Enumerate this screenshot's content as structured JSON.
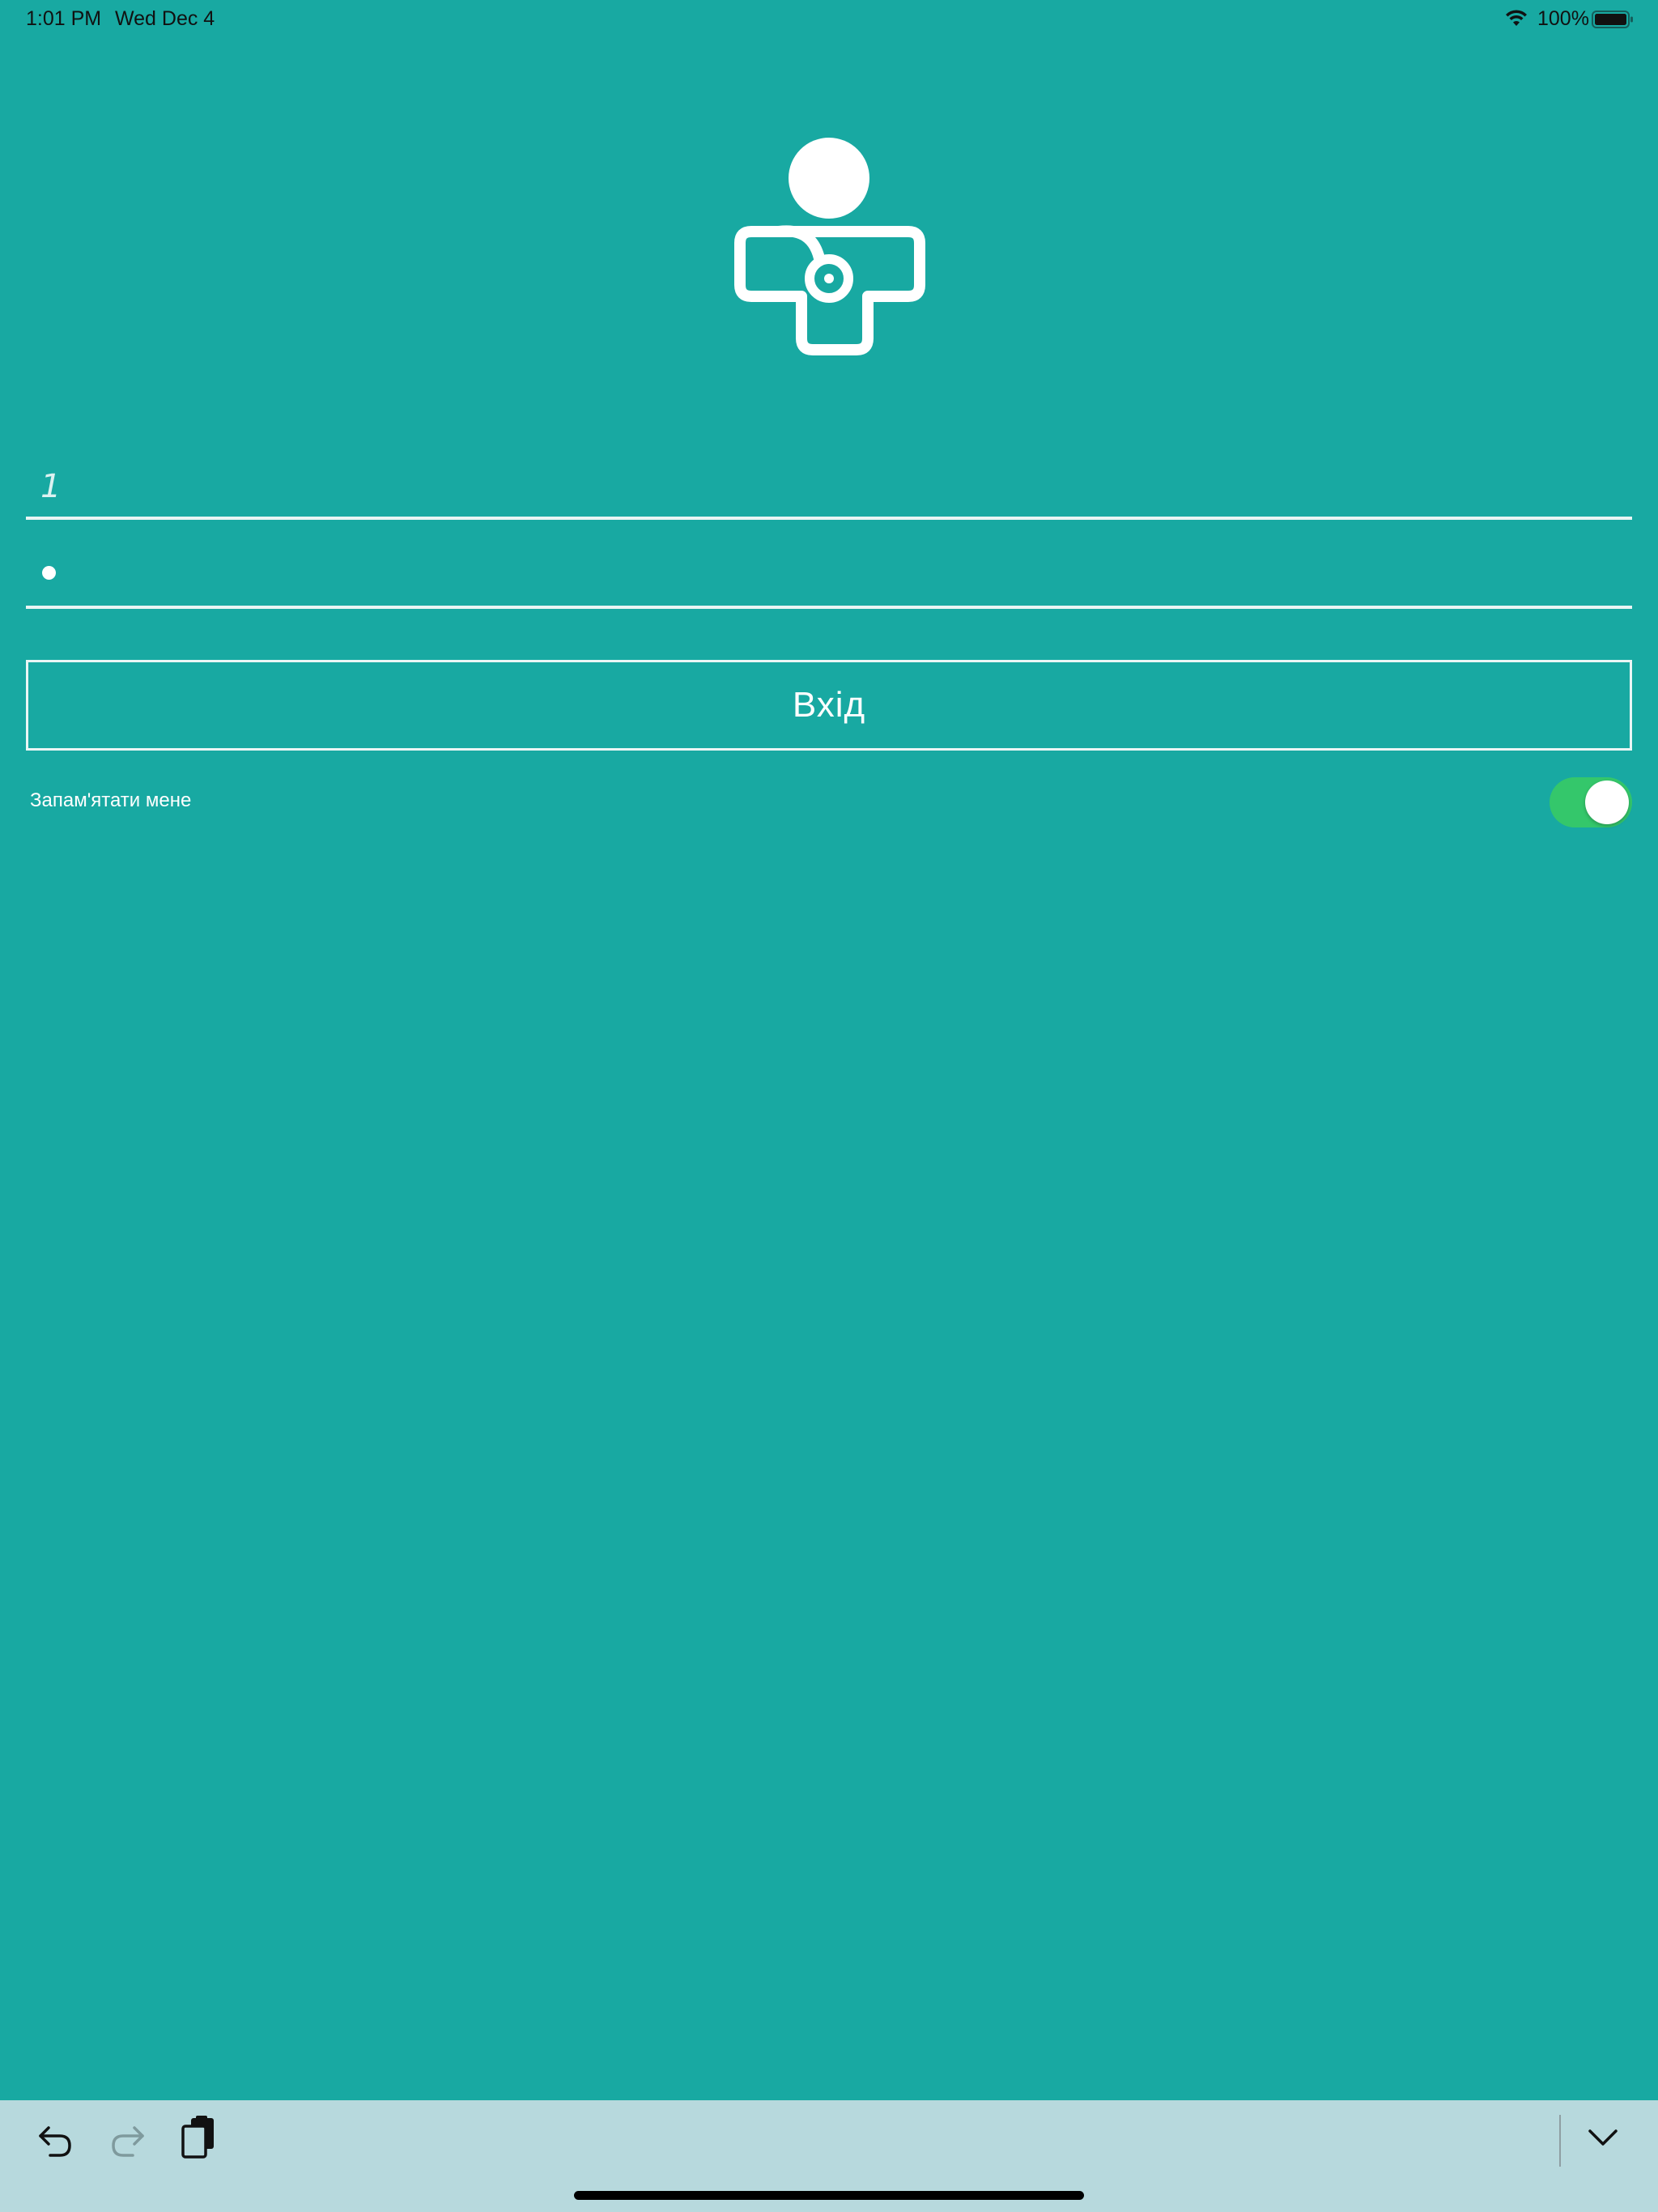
{
  "status_bar": {
    "time": "1:01 PM",
    "date": "Wed Dec 4",
    "battery": "100%"
  },
  "login_form": {
    "username_value": "1",
    "password_masked": "•",
    "login_button_label": "Вхід",
    "remember_me_label": "Запам'ятати мене",
    "remember_me_on": true
  },
  "colors": {
    "background": "#18a9a2",
    "toggle_on": "#34c76b",
    "keyboard_bar": "#b7d9dd"
  },
  "icons": {
    "logo": "doctor-stethoscope-icon",
    "undo": "undo-icon",
    "redo": "redo-icon",
    "paste": "paste-icon",
    "dismiss_keyboard": "chevron-down-icon"
  }
}
